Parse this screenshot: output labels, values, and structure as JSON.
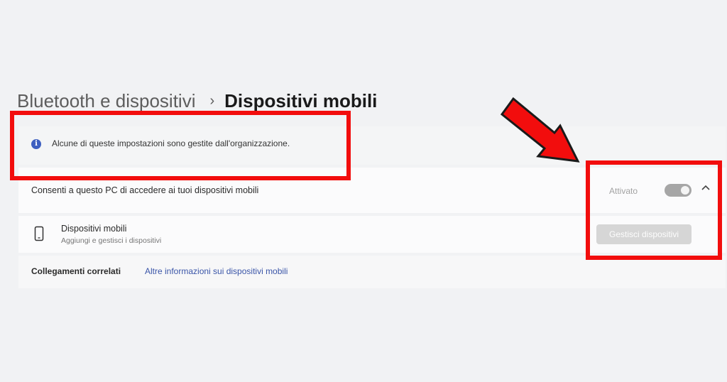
{
  "breadcrumb": {
    "parent": "Bluetooth e dispositivi",
    "separator": "›",
    "current": "Dispositivi mobili"
  },
  "info_bar": {
    "icon": "info-icon",
    "icon_glyph": "i",
    "text": "Alcune di queste impostazioni sono gestite dall'organizzazione."
  },
  "allow_setting": {
    "label": "Consenti a questo PC di accedere ai tuoi dispositivi mobili",
    "status": "Attivato",
    "toggle_on": true,
    "expand_icon": "chevron-up-icon"
  },
  "device_row": {
    "icon": "phone-icon",
    "title": "Dispositivi mobili",
    "subtitle": "Aggiungi e gestisci i dispositivi",
    "button_label": "Gestisci dispositivi",
    "button_disabled": true
  },
  "related_links": {
    "label": "Collegamenti correlati",
    "link_text": "Altre informazioni sui dispositivi mobili"
  },
  "annotations": {
    "highlight_color": "#f20d0d",
    "arrow_color": "#f20d0d"
  }
}
